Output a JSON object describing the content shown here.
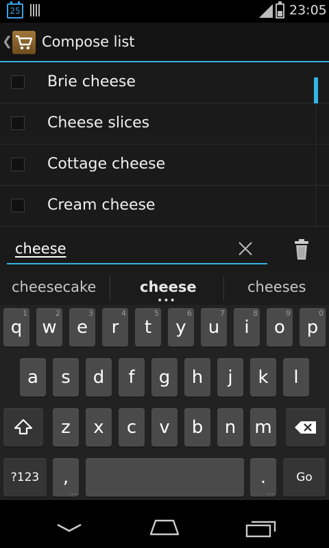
{
  "status_bar": {
    "calendar_day": "25",
    "time": "23:05"
  },
  "action_bar": {
    "title": "Compose list"
  },
  "list": {
    "items": [
      {
        "label": "Brie cheese"
      },
      {
        "label": "Cheese slices"
      },
      {
        "label": "Cottage cheese"
      },
      {
        "label": "Cream cheese"
      }
    ]
  },
  "input": {
    "value": "cheese"
  },
  "suggestions": [
    {
      "label": "cheesecake"
    },
    {
      "label": "cheese"
    },
    {
      "label": "cheeses"
    }
  ],
  "keyboard": {
    "row1": [
      {
        "label": "q",
        "hint": "1"
      },
      {
        "label": "w",
        "hint": "2"
      },
      {
        "label": "e",
        "hint": "3"
      },
      {
        "label": "r",
        "hint": "4"
      },
      {
        "label": "t",
        "hint": "5"
      },
      {
        "label": "y",
        "hint": "6"
      },
      {
        "label": "u",
        "hint": "7"
      },
      {
        "label": "i",
        "hint": "8"
      },
      {
        "label": "o",
        "hint": "9"
      },
      {
        "label": "p",
        "hint": "0"
      }
    ],
    "row2": [
      "a",
      "s",
      "d",
      "f",
      "g",
      "h",
      "j",
      "k",
      "l"
    ],
    "row3": [
      "z",
      "x",
      "c",
      "v",
      "b",
      "n",
      "m"
    ],
    "symbols_label": "?123",
    "comma_label": ",",
    "period_label": ".",
    "go_label": "Go"
  },
  "colors": {
    "accent": "#33b5e5",
    "key": "#4a4a4a",
    "key_dark": "#353535"
  }
}
